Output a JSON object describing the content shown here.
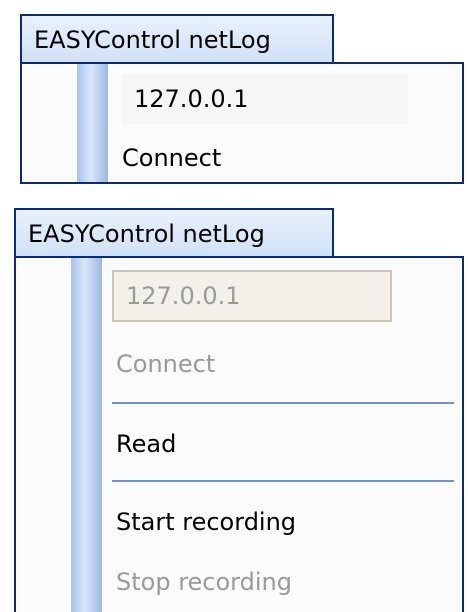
{
  "menus": [
    {
      "tab_label": "EASYControl netLog",
      "ip_value": "127.0.0.1",
      "connect_label": "Connect"
    },
    {
      "tab_label": "EASYControl netLog",
      "ip_value": "127.0.0.1",
      "connect_label": "Connect",
      "read_label": "Read",
      "start_recording_label": "Start recording",
      "stop_recording_label": "Stop recording"
    }
  ],
  "colors": {
    "border": "#0a2a7a",
    "gutter": "#a7c2ea",
    "separator": "#6f92c8",
    "disabled_text": "#9a9a9a"
  }
}
